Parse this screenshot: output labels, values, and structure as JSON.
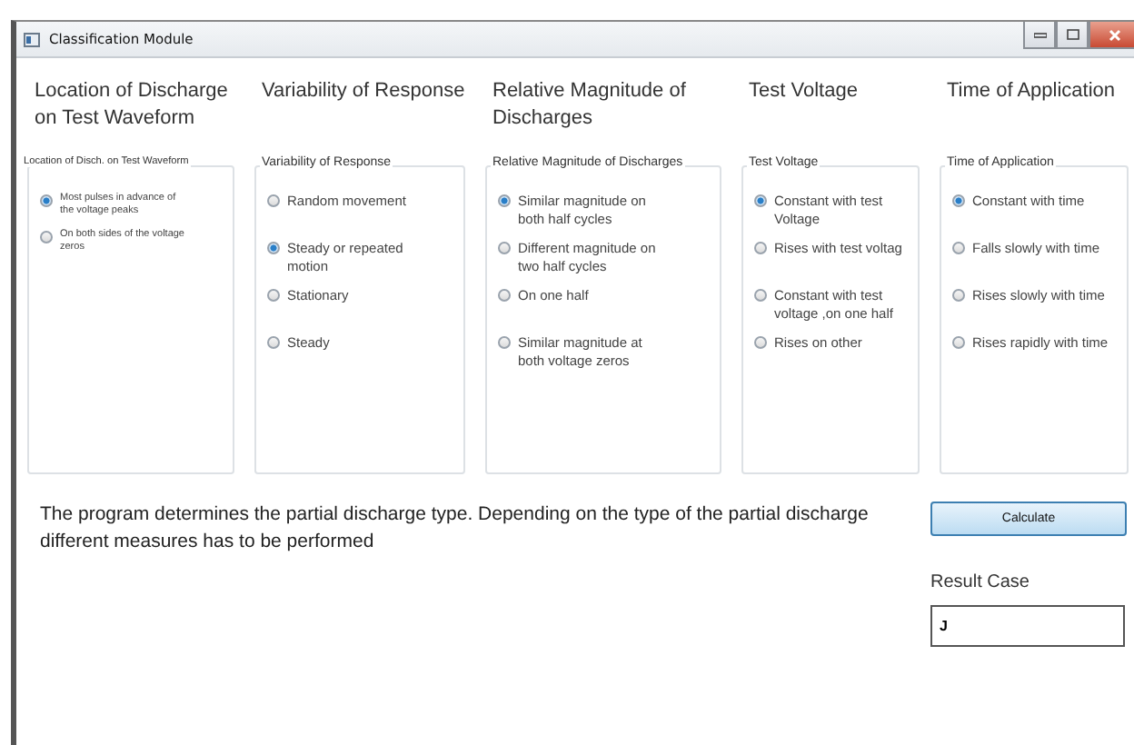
{
  "window": {
    "title": "Classification Module"
  },
  "columns": [
    {
      "heading": "Location of Discharge on Test Waveform",
      "group_title": "Location of Disch. on Test Waveform",
      "compact": true,
      "options": [
        {
          "label": "Most pulses in advance of the voltage peaks",
          "selected": true
        },
        {
          "label": "On both sides of the voltage zeros",
          "selected": false
        }
      ]
    },
    {
      "heading": "Variability of Response",
      "group_title": "Variability of Response",
      "compact": false,
      "options": [
        {
          "label": "Random movement",
          "selected": false
        },
        {
          "label": "Steady or repeated motion",
          "selected": true
        },
        {
          "label": "Stationary",
          "selected": false
        },
        {
          "label": "Steady",
          "selected": false
        }
      ]
    },
    {
      "heading": "Relative Magnitude of Discharges",
      "group_title": "Relative Magnitude of Discharges",
      "compact": false,
      "options": [
        {
          "label": "Similar magnitude on both half cycles",
          "selected": true
        },
        {
          "label": "Different magnitude on two half cycles",
          "selected": false
        },
        {
          "label": "On one half",
          "selected": false
        },
        {
          "label": "Similar magnitude at both voltage zeros",
          "selected": false
        }
      ]
    },
    {
      "heading": "Test Voltage",
      "group_title": "Test Voltage",
      "compact": false,
      "options": [
        {
          "label": "Constant with test Voltage",
          "selected": true
        },
        {
          "label": "Rises with test voltag",
          "selected": false
        },
        {
          "label": "Constant with test voltage ,on one half",
          "selected": false
        },
        {
          "label": "Rises on other",
          "selected": false
        }
      ]
    },
    {
      "heading": "Time of Application",
      "group_title": "Time of Application",
      "compact": false,
      "options": [
        {
          "label": "Constant with time",
          "selected": true
        },
        {
          "label": "Falls slowly with time",
          "selected": false
        },
        {
          "label": "Rises slowly with time",
          "selected": false
        },
        {
          "label": "Rises rapidly with time",
          "selected": false
        }
      ]
    }
  ],
  "description": "The program determines the partial discharge type. Depending on the type of the partial discharge different measures has to be performed",
  "calculate_button": "Calculate",
  "result": {
    "label": "Result Case",
    "value": "J"
  }
}
